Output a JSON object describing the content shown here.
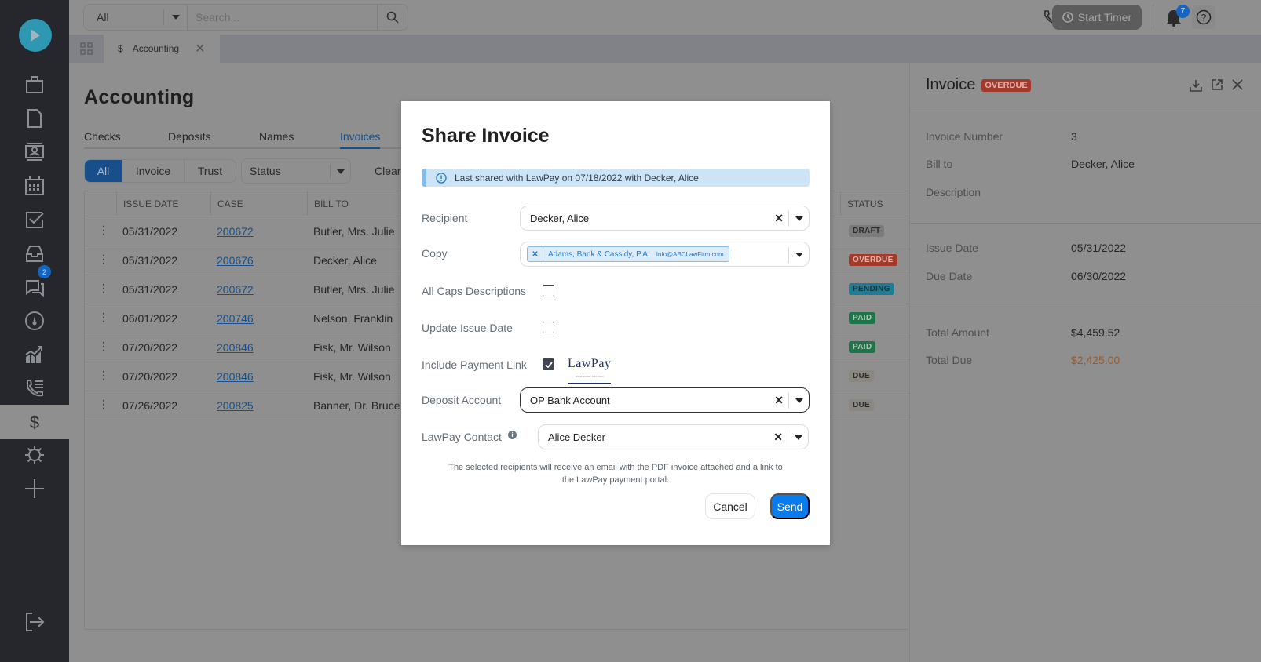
{
  "topbar": {
    "scope": "All",
    "search_placeholder": "Search...",
    "start_timer": "Start Timer",
    "notifications_count": "7"
  },
  "sidebar": {
    "items": [
      {
        "icon": "briefcase-icon",
        "label": "Matters"
      },
      {
        "icon": "document-icon",
        "label": "Documents"
      },
      {
        "icon": "contact-card-icon",
        "label": "Contacts"
      },
      {
        "icon": "calendar-icon",
        "label": "Calendar"
      },
      {
        "icon": "checkbox-icon",
        "label": "Tasks"
      },
      {
        "icon": "inbox-icon",
        "label": "Inbox"
      },
      {
        "icon": "chat-icon",
        "label": "Messages",
        "badge": "2"
      },
      {
        "icon": "dashboard-gauge-icon",
        "label": "Dashboard"
      },
      {
        "icon": "chart-icon",
        "label": "Reports"
      },
      {
        "icon": "phone-list-icon",
        "label": "Calls"
      },
      {
        "icon": "dollar-icon",
        "label": "Accounting",
        "active": true
      },
      {
        "icon": "gear-icon",
        "label": "Settings"
      },
      {
        "icon": "plus-icon",
        "label": "Add"
      }
    ]
  },
  "tabs": [
    {
      "label": "Accounting",
      "icon": "$"
    }
  ],
  "main": {
    "title": "Accounting",
    "nav_tabs": [
      "Checks",
      "Deposits",
      "Names",
      "Invoices"
    ],
    "active_nav": "Invoices",
    "segments": [
      "All",
      "Invoice",
      "Trust"
    ],
    "status_placeholder": "Status",
    "clear_label": "Clear",
    "columns": [
      "ISSUE DATE",
      "CASE",
      "BILL TO",
      "STATUS"
    ],
    "rows": [
      {
        "date": "05/31/2022",
        "case": "200672",
        "bill_to": "Butler, Mrs. Julie",
        "status": "DRAFT"
      },
      {
        "date": "05/31/2022",
        "case": "200676",
        "bill_to": "Decker, Alice",
        "status": "OVERDUE"
      },
      {
        "date": "05/31/2022",
        "case": "200672",
        "bill_to": "Butler, Mrs. Julie",
        "status": "PENDING"
      },
      {
        "date": "06/01/2022",
        "case": "200746",
        "bill_to": "Nelson, Franklin",
        "status": "PAID"
      },
      {
        "date": "07/20/2022",
        "case": "200846",
        "bill_to": "Fisk, Mr. Wilson",
        "status": "PAID"
      },
      {
        "date": "07/20/2022",
        "case": "200846",
        "bill_to": "Fisk, Mr. Wilson",
        "status": "DUE"
      },
      {
        "date": "07/26/2022",
        "case": "200825",
        "bill_to": "Banner, Dr. Bruce",
        "status": "DUE"
      }
    ]
  },
  "status_colors": {
    "DRAFT": {
      "bg": "#7b7b7b",
      "fg": "#2b2b2b"
    },
    "OVERDUE": {
      "bg": "#a03b2c",
      "fg": "#e1b0a6"
    },
    "PENDING": {
      "bg": "#1f7c93",
      "fg": "#1c3640"
    },
    "PAID": {
      "bg": "#1f7449",
      "fg": "#a9c9b6"
    },
    "DUE": {
      "bg": "#8a8780",
      "fg": "#2b2b2b"
    }
  },
  "panel": {
    "title": "Invoice",
    "badge": "OVERDUE",
    "invoice_number_label": "Invoice Number",
    "invoice_number": "3",
    "bill_to_label": "Bill to",
    "bill_to": "Decker, Alice",
    "description_label": "Description",
    "issue_date_label": "Issue Date",
    "issue_date": "05/31/2022",
    "due_date_label": "Due Date",
    "due_date": "06/30/2022",
    "total_amount_label": "Total Amount",
    "total_amount": "$4,459.52",
    "total_due_label": "Total Due",
    "total_due": "$2,425.00"
  },
  "modal": {
    "title": "Share Invoice",
    "alert": "Last shared with LawPay on 07/18/2022  with Decker, Alice",
    "recipient_label": "Recipient",
    "recipient": "Decker, Alice",
    "copy_label": "Copy",
    "copy_name": "Adams, Bank & Cassidy, P.A.",
    "copy_email": "Info@ABCLawFirm.com",
    "all_caps_label": "All Caps Descriptions",
    "all_caps": false,
    "update_issue_label": "Update Issue Date",
    "update_issue": false,
    "payment_link_label": "Include Payment Link",
    "payment_link": true,
    "lawpay_logo": "LawPay",
    "lawpay_tagline": "AN AFFINIPAY SOLUTION",
    "deposit_label": "Deposit Account",
    "deposit": "OP Bank Account",
    "contact_label": "LawPay Contact",
    "contact": "Alice Decker",
    "note": "The selected recipients will receive an email with the PDF invoice attached and a link to the LawPay payment portal.",
    "cancel": "Cancel",
    "send": "Send"
  }
}
